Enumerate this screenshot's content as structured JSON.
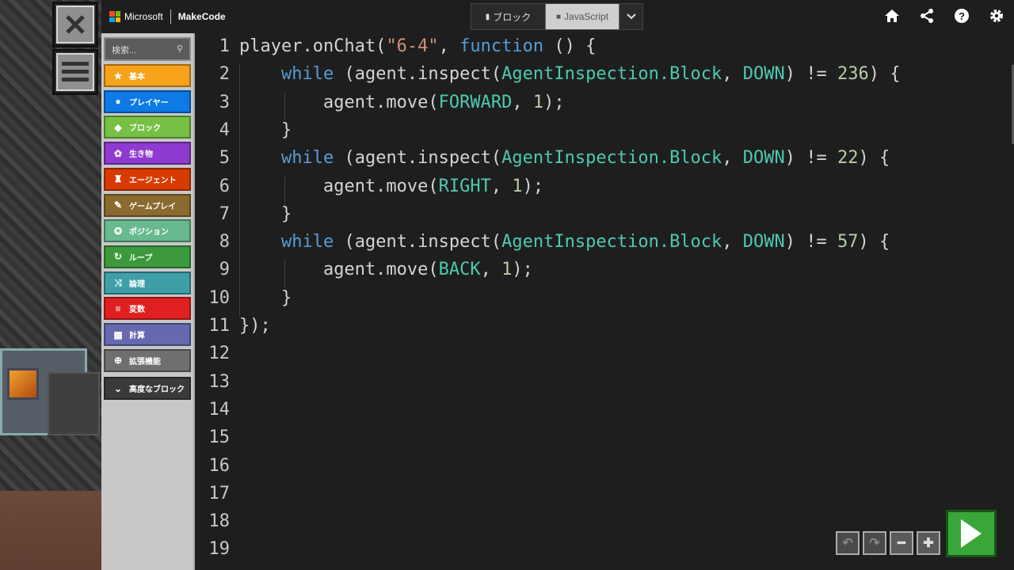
{
  "header": {
    "brand": "Microsoft",
    "product": "MakeCode",
    "tabs": [
      {
        "label": "ブロック",
        "active": false
      },
      {
        "label": "JavaScript",
        "active": true
      }
    ]
  },
  "toolbox": {
    "search_placeholder": "検索...",
    "categories": [
      {
        "label": "基本",
        "color": "#f7a21b",
        "icon": "star-icon"
      },
      {
        "label": "プレイヤー",
        "color": "#0d7ae6",
        "icon": "person-icon"
      },
      {
        "label": "ブロック",
        "color": "#76c043",
        "icon": "cube-icon"
      },
      {
        "label": "生き物",
        "color": "#8f3ad0",
        "icon": "paw-icon"
      },
      {
        "label": "エージェント",
        "color": "#d83b01",
        "icon": "agent-icon"
      },
      {
        "label": "ゲームプレイ",
        "color": "#8a6a2e",
        "icon": "wrench-icon"
      },
      {
        "label": "ポジション",
        "color": "#68b890",
        "icon": "compass-icon"
      },
      {
        "label": "ループ",
        "color": "#3c9a3c",
        "icon": "loop-icon"
      },
      {
        "label": "論理",
        "color": "#3f9fa8",
        "icon": "shuffle-icon"
      },
      {
        "label": "変数",
        "color": "#e02020",
        "icon": "list-icon"
      },
      {
        "label": "計算",
        "color": "#6669b0",
        "icon": "calculator-icon"
      },
      {
        "label": "拡張機能",
        "color": "#6f6f6f",
        "icon": "plus-circle-icon"
      },
      {
        "label": "高度なブロック",
        "color": "#3a3a3a",
        "icon": "chevron-down-icon"
      }
    ]
  },
  "editor": {
    "line_numbers": [
      "1",
      "2",
      "3",
      "4",
      "5",
      "6",
      "7",
      "8",
      "9",
      "10",
      "11",
      "12",
      "13",
      "14",
      "15",
      "16",
      "17",
      "18",
      "19"
    ],
    "code_lines": [
      "player.onChat(\"6-4\", function () {",
      "    while (agent.inspect(AgentInspection.Block, DOWN) != 236) {",
      "        agent.move(FORWARD, 1);",
      "    }",
      "    while (agent.inspect(AgentInspection.Block, DOWN) != 22) {",
      "        agent.move(RIGHT, 1);",
      "    }",
      "    while (agent.inspect(AgentInspection.Block, DOWN) != 57) {",
      "        agent.move(BACK, 1);",
      "    }",
      "});"
    ]
  },
  "colors": {
    "keyword": "#569cd6",
    "string": "#ce9178",
    "number": "#b5cea8",
    "type": "#4ec9b0",
    "run_button": "#3aa63a"
  }
}
